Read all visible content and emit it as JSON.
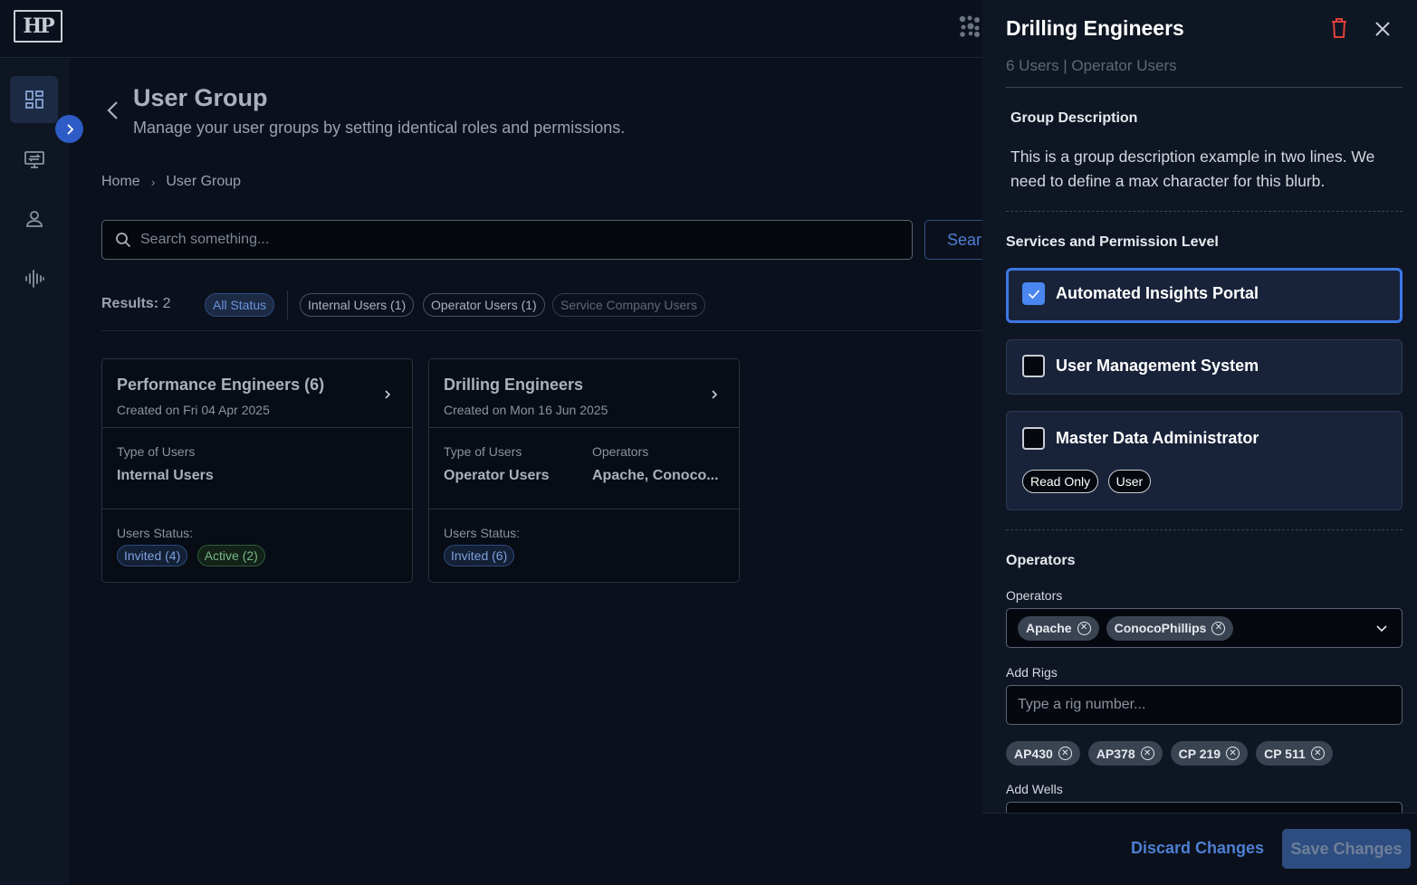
{
  "app": {
    "logo_text": "HP"
  },
  "sidebar": {
    "items": [
      {
        "icon": "dashboard-icon",
        "active": true
      },
      {
        "icon": "monitor-icon",
        "active": false
      },
      {
        "icon": "user-icon",
        "active": false
      },
      {
        "icon": "waveform-icon",
        "active": false
      }
    ]
  },
  "main": {
    "title": "User Group",
    "subtitle": "Manage your user groups by setting identical roles and permissions.",
    "breadcrumb": [
      "Home",
      "User Group"
    ],
    "search": {
      "placeholder": "Search something...",
      "button_label": "Sear"
    },
    "results": {
      "label": "Results:",
      "count": "2"
    },
    "filters": [
      {
        "label": "All Status",
        "selected": true
      },
      {
        "label": "Internal Users (1)",
        "selected": false
      },
      {
        "label": "Operator Users (1)",
        "selected": false
      },
      {
        "label": "Service Company Users",
        "selected": false
      }
    ],
    "cards": [
      {
        "title": "Performance Engineers (6)",
        "date": "Created on Fri 04 Apr 2025",
        "type_label": "Type of Users",
        "type_value": "Internal Users",
        "status_label": "Users Status:",
        "statuses": [
          {
            "label": "Invited (4)",
            "color": "blue"
          },
          {
            "label": "Active (2)",
            "color": "green"
          }
        ]
      },
      {
        "title": "Drilling Engineers",
        "date": "Created on Mon 16 Jun 2025",
        "type_label": "Type of Users",
        "type_value": "Operator Users",
        "operators_label": "Operators",
        "operators_value": "Apache, Conoco...",
        "status_label": "Users Status:",
        "statuses": [
          {
            "label": "Invited (6)",
            "color": "blue"
          }
        ]
      }
    ]
  },
  "panel": {
    "title": "Drilling Engineers",
    "subtitle": "6 Users | Operator Users",
    "description_title": "Group Description",
    "description": "This is a group description example in two lines. We need to define a max character for this blurb.",
    "services_title": "Services and Permission Level",
    "services": [
      {
        "label": "Automated Insights Portal",
        "checked": true
      },
      {
        "label": "User Management System",
        "checked": false
      },
      {
        "label": "Master Data Administrator",
        "checked": false,
        "roles": [
          "Read Only",
          "User"
        ]
      }
    ],
    "operators_section": "Operators",
    "operators_field_label": "Operators",
    "operators_selected": [
      "Apache",
      "ConocoPhillips"
    ],
    "rigs_label": "Add Rigs",
    "rigs_placeholder": "Type a rig number...",
    "rigs": [
      "AP430",
      "AP378",
      "CP 219",
      "CP 511"
    ],
    "wells_label": "Add Wells",
    "discard_label": "Discard Changes",
    "save_label": "Save Changes"
  },
  "colors": {
    "accent": "#3d76e4",
    "background": "#0b111c",
    "panel": "#0f1623",
    "danger": "#e0413a"
  }
}
